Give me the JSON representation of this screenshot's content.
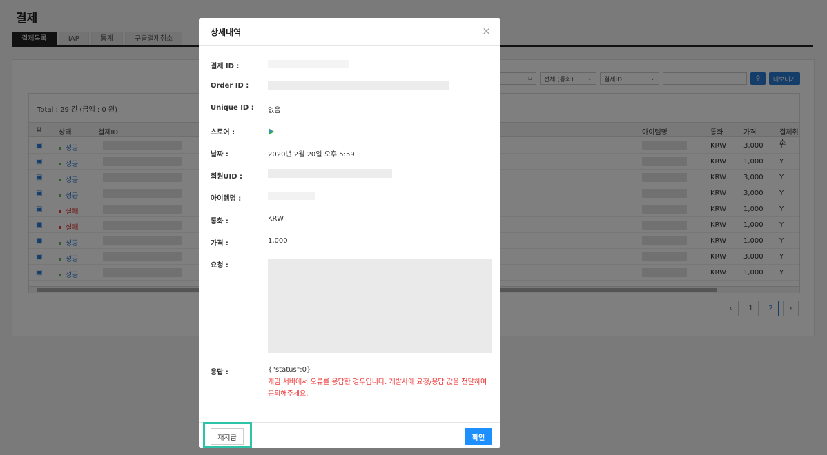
{
  "page": {
    "title": "결제"
  },
  "tabs": [
    {
      "label": "결제목록"
    },
    {
      "label": "IAP"
    },
    {
      "label": "통계"
    },
    {
      "label": "구글결제취소"
    }
  ],
  "filters": {
    "currency": "전체 (통화)",
    "field": "결제ID",
    "export_label": "내보내기"
  },
  "table": {
    "total": "Total : 29 건 (금액 : 0 원)",
    "columns": {
      "status": "상태",
      "payment_id": "결제ID",
      "item_name": "아이템명",
      "currency": "통화",
      "price": "가격",
      "cancel": "결제취소"
    },
    "rows": [
      {
        "status": "성공",
        "type": "ok",
        "currency": "KRW",
        "price": "3,000",
        "cancel": "Y"
      },
      {
        "status": "성공",
        "type": "ok",
        "currency": "KRW",
        "price": "1,000",
        "cancel": "Y"
      },
      {
        "status": "성공",
        "type": "ok",
        "currency": "KRW",
        "price": "3,000",
        "cancel": "Y"
      },
      {
        "status": "성공",
        "type": "ok",
        "currency": "KRW",
        "price": "3,000",
        "cancel": "Y"
      },
      {
        "status": "실패",
        "type": "fail",
        "currency": "KRW",
        "price": "1,000",
        "cancel": "Y"
      },
      {
        "status": "실패",
        "type": "fail",
        "currency": "KRW",
        "price": "1,000",
        "cancel": "Y"
      },
      {
        "status": "성공",
        "type": "ok",
        "currency": "KRW",
        "price": "1,000",
        "cancel": "Y"
      },
      {
        "status": "성공",
        "type": "ok",
        "currency": "KRW",
        "price": "3,000",
        "cancel": "Y"
      },
      {
        "status": "성공",
        "type": "ok",
        "currency": "KRW",
        "price": "1,000",
        "cancel": "Y"
      }
    ]
  },
  "pagination": {
    "prev": "‹",
    "page1": "1",
    "page2": "2",
    "next": "›"
  },
  "modal": {
    "title": "상세내역",
    "close": "×",
    "labels": {
      "payment_id": "결제 ID :",
      "order_id": "Order ID :",
      "unique_id": "Unique ID :",
      "store": "스토어 :",
      "date": "날짜 :",
      "member_uid": "회원UID :",
      "item_name": "아이템명 :",
      "currency": "통화 :",
      "price": "가격 :",
      "request": "요청 :",
      "response": "응답 :"
    },
    "values": {
      "unique_id": "없음",
      "date": "2020년 2월 20일 오후 5:59",
      "currency": "KRW",
      "price": "1,000",
      "response": "{\"status\":0}"
    },
    "error_message": "게임 서버에서 오류를 응답한 경우입니다. 개발사에 요청/응답 값을 전달하여 문의해주세요.",
    "retry_label": "재지급",
    "confirm_label": "확인"
  }
}
